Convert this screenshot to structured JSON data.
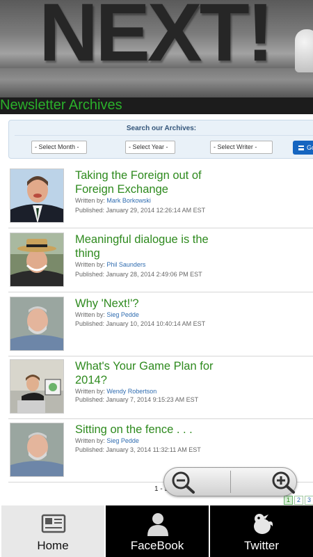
{
  "banner": {
    "logo_text": "NEXT!"
  },
  "page": {
    "heading": "Newsletter Archives"
  },
  "search": {
    "title": "Search our Archives:",
    "month": "- Select Month -",
    "year": "- Select Year -",
    "writer": "- Select Writer -",
    "go_label": "Go"
  },
  "articles": [
    {
      "title": "Taking the Foreign out of Foreign Exchange",
      "written_by_label": "Written by:",
      "author": "Mark Borkowski",
      "published": "Published: January 29, 2014 12:26:14 AM EST"
    },
    {
      "title": "Meaningful dialogue is the thing",
      "written_by_label": "Written by:",
      "author": "Phil Saunders",
      "published": "Published: January 28, 2014 2:49:06 PM EST"
    },
    {
      "title": "Why 'Next!'?",
      "written_by_label": "Written by:",
      "author": "Sieg Pedde",
      "published": "Published: January 10, 2014 10:40:14 AM EST"
    },
    {
      "title": "What's Your Game Plan for 2014?",
      "written_by_label": "Written by:",
      "author": "Wendy Robertson",
      "published": "Published: January 7, 2014 9:15:23 AM EST"
    },
    {
      "title": "Sitting on the fence . . .",
      "written_by_label": "Written by:",
      "author": "Sieg Pedde",
      "published": "Published: January 3, 2014 11:32:11 AM EST"
    }
  ],
  "pagination": {
    "range_text": "1 - 5",
    "pages": [
      "1",
      "2",
      "3"
    ],
    "current": "1"
  },
  "tabs": [
    {
      "label": "Home",
      "icon": "home-icon"
    },
    {
      "label": "FaceBook",
      "icon": "facebook-person-icon"
    },
    {
      "label": "Twitter",
      "icon": "twitter-bird-icon"
    }
  ],
  "colors": {
    "title_green": "#2e8a1e",
    "heading_green": "#2bb02b",
    "link_blue": "#2f6cb0",
    "go_blue": "#1565c0"
  }
}
